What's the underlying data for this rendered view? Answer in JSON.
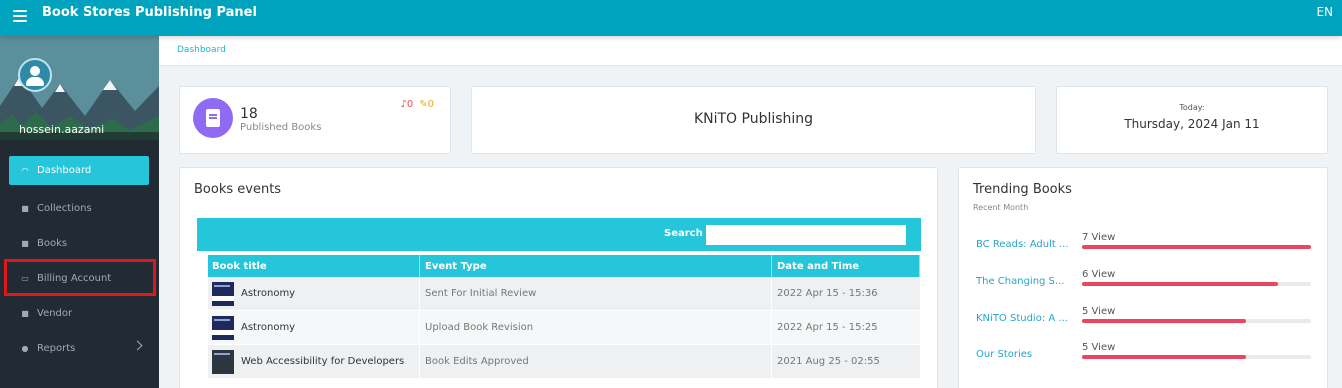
{
  "header": {
    "title": "Book Stores Publishing Panel",
    "language": "EN"
  },
  "profile": {
    "username": "hossein.aazami"
  },
  "sidebar": {
    "items": [
      {
        "label": "Dashboard",
        "icon": "dashboard-icon",
        "active": true
      },
      {
        "label": "Collections",
        "icon": "book-icon"
      },
      {
        "label": "Books",
        "icon": "book-icon"
      },
      {
        "label": "Billing Account",
        "icon": "money-icon"
      },
      {
        "label": "Vendor",
        "icon": "vendor-icon"
      },
      {
        "label": "Reports",
        "icon": "user-icon",
        "has_submenu": true
      }
    ]
  },
  "breadcrumb": "Dashboard",
  "stats": {
    "published_count": "18",
    "published_label": "Published Books",
    "notifications": "0",
    "edits": "0"
  },
  "publisher": {
    "name": "KNiTO Publishing"
  },
  "today": {
    "label": "Today:",
    "date": "Thursday, 2024 Jan 11"
  },
  "books_events": {
    "title": "Books events",
    "search_label": "Search",
    "search_value": "",
    "columns": [
      "Book title",
      "Event Type",
      "Date and Time"
    ],
    "rows": [
      {
        "title": "Astronomy",
        "event": "Sent For Initial Review",
        "datetime": "2022 Apr 15 - 15:36"
      },
      {
        "title": "Astronomy",
        "event": "Upload Book Revision",
        "datetime": "2022 Apr 15 - 15:25"
      },
      {
        "title": "Web Accessibility for Developers",
        "event": "Book Edits Approved",
        "datetime": "2021 Aug 25 - 02:55"
      }
    ]
  },
  "trending": {
    "title": "Trending Books",
    "subtitle": "Recent Month",
    "items": [
      {
        "name": "BC Reads: Adult ...",
        "views": "7 View",
        "fraction": 1.0
      },
      {
        "name": "The Changing S...",
        "views": "6 View",
        "fraction": 0.857
      },
      {
        "name": "KNiTO Studio: A ...",
        "views": "5 View",
        "fraction": 0.714
      },
      {
        "name": "Our Stories",
        "views": "5 View",
        "fraction": 0.714
      }
    ]
  },
  "colors": {
    "topbar": "#00a3bd",
    "accent": "#26c6da",
    "sidebar": "#222b34",
    "bar": "#ec4561",
    "stat_icon": "#8e6bf2"
  }
}
